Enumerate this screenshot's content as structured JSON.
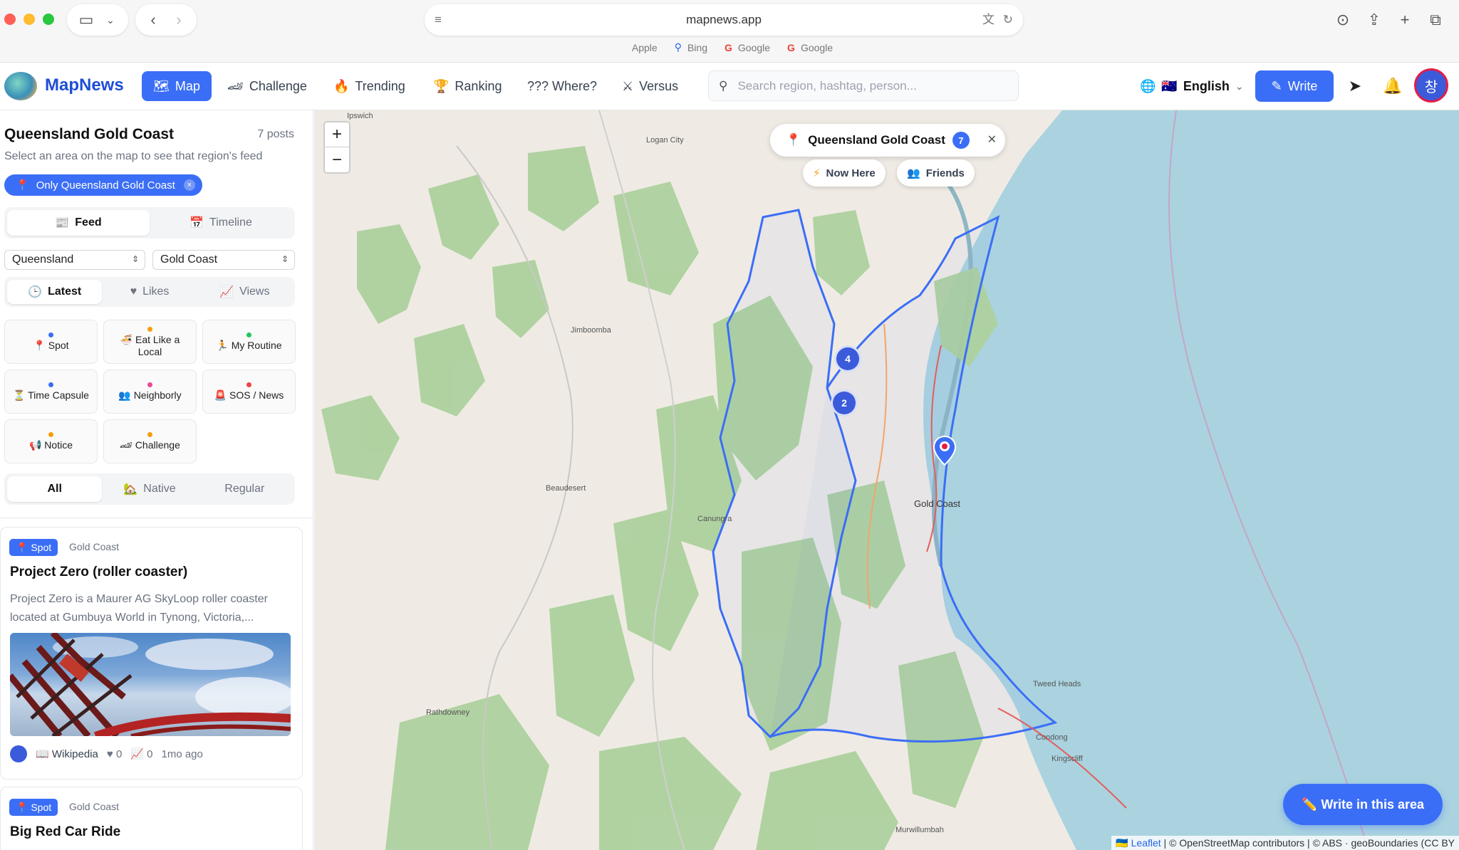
{
  "browser": {
    "url": "mapnews.app",
    "favorites": [
      {
        "label": "Apple",
        "icon": "apple-icon"
      },
      {
        "label": "Bing",
        "icon": "search-icon"
      },
      {
        "label": "Google",
        "icon": "google-icon"
      },
      {
        "label": "Google",
        "icon": "google-icon"
      }
    ]
  },
  "header": {
    "brand": "MapNews",
    "tabs": [
      {
        "label": "Map",
        "icon": "map-icon"
      },
      {
        "label": "Challenge",
        "icon": "car-icon"
      },
      {
        "label": "Trending",
        "icon": "fire-icon"
      },
      {
        "label": "Ranking",
        "icon": "trophy-icon"
      },
      {
        "label": "??? Where?",
        "icon": ""
      },
      {
        "label": "Versus",
        "icon": "swords-icon"
      }
    ],
    "search_placeholder": "Search region, hashtag, person...",
    "language": "English",
    "write_label": "Write",
    "avatar_initial": "창"
  },
  "sidebar": {
    "region_title": "Queensland Gold Coast",
    "post_count": "7 posts",
    "hint": "Select an area on the map to see that region's feed",
    "filter_chip": "Only Queensland Gold Coast",
    "view_tabs": [
      {
        "label": "Feed",
        "icon": "📰"
      },
      {
        "label": "Timeline",
        "icon": "📅"
      }
    ],
    "state_select": "Queensland",
    "city_select": "Gold Coast",
    "sort_tabs": [
      {
        "label": "Latest",
        "icon": "🕒"
      },
      {
        "label": "Likes",
        "icon": "♥"
      },
      {
        "label": "Views",
        "icon": "📈"
      }
    ],
    "categories": [
      {
        "label": "📍 Spot",
        "dot": "#3b6ef6"
      },
      {
        "label": "🍜 Eat Like a Local",
        "dot": "#f59e0b"
      },
      {
        "label": "🏃 My Routine",
        "dot": "#22c55e"
      },
      {
        "label": "⏳ Time Capsule",
        "dot": "#3b6ef6"
      },
      {
        "label": "👥 Neighborly",
        "dot": "#ec4899"
      },
      {
        "label": "🚨 SOS / News",
        "dot": "#ef4444"
      },
      {
        "label": "📢 Notice",
        "dot": "#f59e0b"
      },
      {
        "label": "🏎 Challenge",
        "dot": "#f59e0b"
      }
    ],
    "audience_tabs": [
      {
        "label": "All",
        "icon": ""
      },
      {
        "label": "Native",
        "icon": "🏡"
      },
      {
        "label": "Regular",
        "icon": ""
      }
    ]
  },
  "posts": [
    {
      "badge": "📍 Spot",
      "location": "Gold Coast",
      "title": "Project Zero (roller coaster)",
      "description": "Project Zero is a Maurer AG SkyLoop roller coaster located at Gumbuya World in Tynong, Victoria,...",
      "source": "📖 Wikipedia",
      "likes": "♥ 0",
      "views": "📈 0",
      "age": "1mo ago"
    },
    {
      "badge": "📍 Spot",
      "location": "Gold Coast",
      "title": "Big Red Car Ride"
    }
  ],
  "map": {
    "zoom_in": "+",
    "zoom_out": "−",
    "region_pill": "Queensland Gold Coast",
    "region_count": "7",
    "now_here": "Now Here",
    "friends": "Friends",
    "clusters": [
      "4",
      "2"
    ],
    "fab": "✏️ Write in this area",
    "attribution_leaflet": "Leaflet",
    "attribution_rest": " | © OpenStreetMap contributors | © ABS · geoBoundaries (CC BY",
    "labels": {
      "ipswich": "Ipswich",
      "logan": "Logan City",
      "jimboomba": "Jimboomba",
      "beaudesert": "Beaudesert",
      "canungra": "Canungra",
      "goldcoast": "Gold Coast",
      "rathdowney": "Rathdowney",
      "murwillumbah": "Murwillumbah",
      "tweedheads": "Tweed Heads",
      "kingscliff": "Kingscliff",
      "condong": "Condong"
    }
  },
  "colors": {
    "accent": "#3b6ef6",
    "water": "#aad3df",
    "forest": "#add19e"
  }
}
